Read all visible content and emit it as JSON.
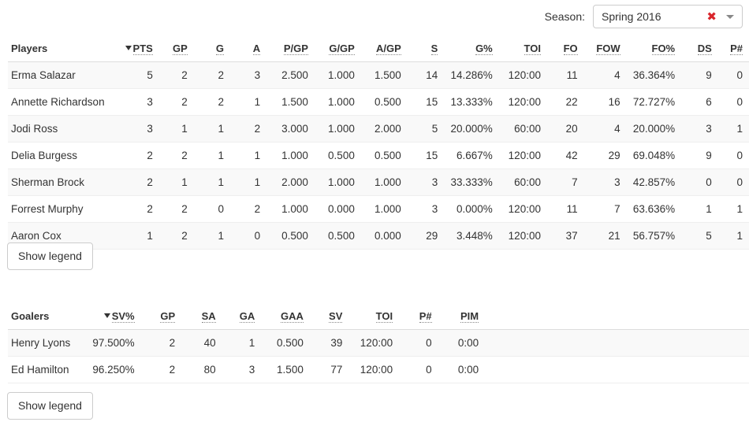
{
  "season": {
    "label": "Season:",
    "selected": "Spring 2016",
    "clear_icon": "clear-x-icon",
    "caret_icon": "chevron-down-icon",
    "clear_color": "#d9262c"
  },
  "players_table": {
    "sort_column": "PTS",
    "sort_direction": "desc",
    "columns": [
      "Players",
      "PTS",
      "GP",
      "G",
      "A",
      "P/GP",
      "G/GP",
      "A/GP",
      "S",
      "G%",
      "TOI",
      "FO",
      "FOW",
      "FO%",
      "DS",
      "P#"
    ],
    "rows": [
      {
        "name": "Erma Salazar",
        "pts": "5",
        "gp": "2",
        "g": "2",
        "a": "3",
        "p_gp": "2.500",
        "g_gp": "1.000",
        "a_gp": "1.500",
        "s": "14",
        "g_pct": "14.286%",
        "toi": "120:00",
        "fo": "11",
        "fow": "4",
        "fo_pct": "36.364%",
        "ds": "9",
        "p_num": "0"
      },
      {
        "name": "Annette Richardson",
        "pts": "3",
        "gp": "2",
        "g": "2",
        "a": "1",
        "p_gp": "1.500",
        "g_gp": "1.000",
        "a_gp": "0.500",
        "s": "15",
        "g_pct": "13.333%",
        "toi": "120:00",
        "fo": "22",
        "fow": "16",
        "fo_pct": "72.727%",
        "ds": "6",
        "p_num": "0"
      },
      {
        "name": "Jodi Ross",
        "pts": "3",
        "gp": "1",
        "g": "1",
        "a": "2",
        "p_gp": "3.000",
        "g_gp": "1.000",
        "a_gp": "2.000",
        "s": "5",
        "g_pct": "20.000%",
        "toi": "60:00",
        "fo": "20",
        "fow": "4",
        "fo_pct": "20.000%",
        "ds": "3",
        "p_num": "1"
      },
      {
        "name": "Delia Burgess",
        "pts": "2",
        "gp": "2",
        "g": "1",
        "a": "1",
        "p_gp": "1.000",
        "g_gp": "0.500",
        "a_gp": "0.500",
        "s": "15",
        "g_pct": "6.667%",
        "toi": "120:00",
        "fo": "42",
        "fow": "29",
        "fo_pct": "69.048%",
        "ds": "9",
        "p_num": "0"
      },
      {
        "name": "Sherman Brock",
        "pts": "2",
        "gp": "1",
        "g": "1",
        "a": "1",
        "p_gp": "2.000",
        "g_gp": "1.000",
        "a_gp": "1.000",
        "s": "3",
        "g_pct": "33.333%",
        "toi": "60:00",
        "fo": "7",
        "fow": "3",
        "fo_pct": "42.857%",
        "ds": "0",
        "p_num": "0"
      },
      {
        "name": "Forrest Murphy",
        "pts": "2",
        "gp": "2",
        "g": "0",
        "a": "2",
        "p_gp": "1.000",
        "g_gp": "0.000",
        "a_gp": "1.000",
        "s": "3",
        "g_pct": "0.000%",
        "toi": "120:00",
        "fo": "11",
        "fow": "7",
        "fo_pct": "63.636%",
        "ds": "1",
        "p_num": "1"
      },
      {
        "name": "Aaron Cox",
        "pts": "1",
        "gp": "2",
        "g": "1",
        "a": "0",
        "p_gp": "0.500",
        "g_gp": "0.500",
        "a_gp": "0.000",
        "s": "29",
        "g_pct": "3.448%",
        "toi": "120:00",
        "fo": "37",
        "fow": "21",
        "fo_pct": "56.757%",
        "ds": "5",
        "p_num": "1"
      }
    ],
    "legend_button": "Show legend"
  },
  "goalers_table": {
    "sort_column": "SV%",
    "sort_direction": "desc",
    "columns": [
      "Goalers",
      "SV%",
      "GP",
      "SA",
      "GA",
      "GAA",
      "SV",
      "TOI",
      "P#",
      "PIM"
    ],
    "rows": [
      {
        "name": "Henry Lyons",
        "sv_pct": "97.500%",
        "gp": "2",
        "sa": "40",
        "ga": "1",
        "gaa": "0.500",
        "sv": "39",
        "toi": "120:00",
        "p_num": "0",
        "pim": "0:00"
      },
      {
        "name": "Ed Hamilton",
        "sv_pct": "96.250%",
        "gp": "2",
        "sa": "80",
        "ga": "3",
        "gaa": "1.500",
        "sv": "77",
        "toi": "120:00",
        "p_num": "0",
        "pim": "0:00"
      }
    ],
    "legend_button": "Show legend"
  }
}
